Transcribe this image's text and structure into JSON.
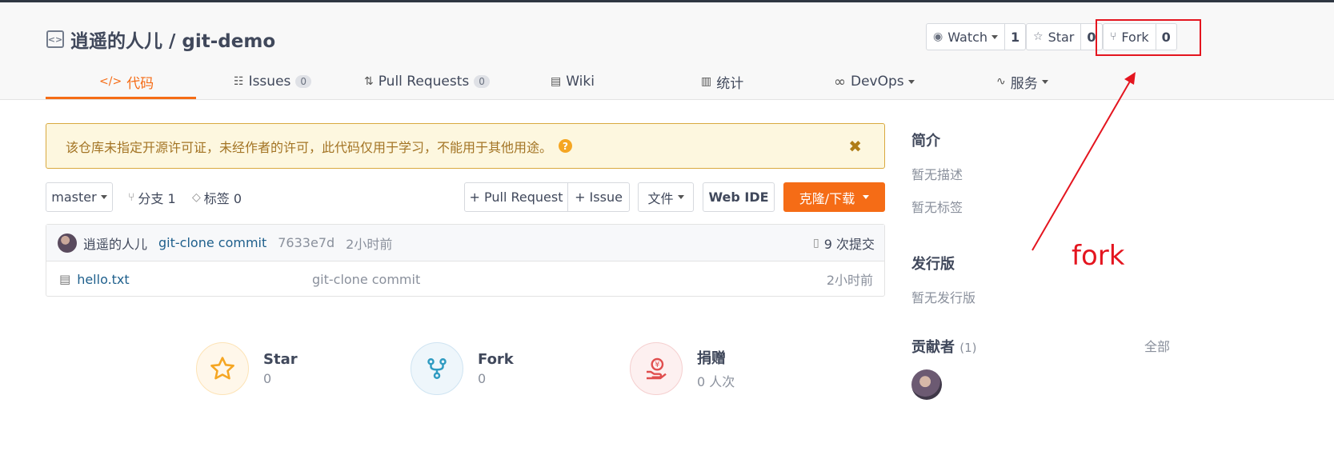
{
  "repo": {
    "owner": "逍遥的人儿",
    "name": "git-demo",
    "title": "逍遥的人儿 / git-demo"
  },
  "actions": {
    "watch": {
      "label": "Watch",
      "count": "1"
    },
    "star": {
      "label": "Star",
      "count": "0"
    },
    "fork": {
      "label": "Fork",
      "count": "0"
    }
  },
  "tabs": [
    {
      "label": "代码",
      "icon": "code-icon",
      "active": true
    },
    {
      "label": "Issues",
      "badge": "0",
      "icon": "issues-icon"
    },
    {
      "label": "Pull Requests",
      "badge": "0",
      "icon": "pull-request-icon"
    },
    {
      "label": "Wiki",
      "icon": "wiki-icon"
    },
    {
      "label": "统计",
      "icon": "stats-icon"
    },
    {
      "label": "DevOps",
      "icon": "devops-icon",
      "dropdown": true
    },
    {
      "label": "服务",
      "icon": "service-icon",
      "dropdown": true
    }
  ],
  "notice": {
    "text": "该仓库未指定开源许可证，未经作者的许可，此代码仅用于学习，不能用于其他用途。"
  },
  "toolbar": {
    "branch": "master",
    "branches": "分支 1",
    "tags": "标签 0",
    "pull_request": "+ Pull Request",
    "issue": "+ Issue",
    "file": "文件",
    "web_ide": "Web IDE",
    "clone": "克隆/下载"
  },
  "commit": {
    "author": "逍遥的人儿",
    "message": "git-clone commit",
    "hash": "7633e7d",
    "time": "2小时前",
    "count": "9 次提交"
  },
  "files": [
    {
      "name": "hello.txt",
      "message": "git-clone commit",
      "time": "2小时前"
    }
  ],
  "stats": {
    "star": {
      "label": "Star",
      "value": "0"
    },
    "fork": {
      "label": "Fork",
      "value": "0"
    },
    "donate": {
      "label": "捐赠",
      "value": "0 人次"
    }
  },
  "sidebar": {
    "intro_title": "简介",
    "no_desc": "暂无描述",
    "no_tags": "暂无标签",
    "release_title": "发行版",
    "no_release": "暂无发行版",
    "contributors_title": "贡献者",
    "contributors_count": "(1)",
    "all": "全部"
  },
  "annotation": {
    "text": "fork",
    "color": "#e4151f"
  },
  "colors": {
    "accent": "#f56c16",
    "annotation": "#e4151f",
    "notice_bg": "#fdf7df"
  }
}
